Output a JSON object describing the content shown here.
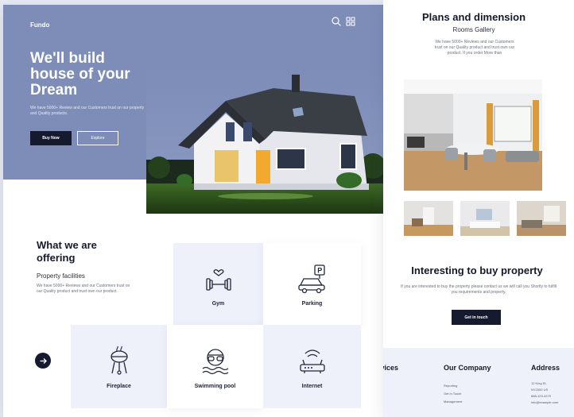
{
  "left_page": {
    "brand": "Fundo",
    "header_icons": [
      "search-icon",
      "grid-icon"
    ],
    "hero": {
      "headline_lines": [
        "We'll build",
        "house of your",
        "Dream"
      ],
      "description": "We have 5000+ Review and our Customers trust on our property and Quality products.",
      "buy_button": "Buy Now",
      "explore_button": "Explore"
    },
    "offering": {
      "title": "What we are offering",
      "subtitle": "Property facilities",
      "description": "We have 5000+ Reviews and our Customers trust on our Quality product and trust own our product.",
      "facilities": [
        {
          "label": "Gym",
          "icon": "gym-icon"
        },
        {
          "label": "Parking",
          "icon": "parking-icon"
        },
        {
          "label": "Fireplace",
          "icon": "fireplace-icon"
        },
        {
          "label": "Swimming pool",
          "icon": "swimming-pool-icon"
        },
        {
          "label": "Internet",
          "icon": "internet-icon"
        }
      ]
    }
  },
  "right_page": {
    "plans_title": "Plans and dimension",
    "plans_subtitle": "Rooms Gallery",
    "plans_description": "We have 5000+ Reviews and our Customers trust on our Quality product and trust own our product. If you order More than",
    "buy_title": "Interesting to buy property",
    "buy_description": "If you are interested to buy the property please contact us we will call you Shortly to fulfill you requirements and property.",
    "get_in_touch": "Get in touch",
    "footer": {
      "services_heading": "Services",
      "company_heading": "Our Company",
      "company_links": [
        "Reporting",
        "Get in Touch",
        "Management"
      ],
      "address_heading": "Address",
      "address_lines": [
        "12 King St,",
        "NY2000 US",
        "888-123-4279",
        "info@example.com"
      ]
    }
  },
  "colors": {
    "hero_bg": "#7d8db8",
    "dark_button": "#161a2e",
    "card_blue": "#eef1fa",
    "page_bg": "#e9ecf4"
  }
}
